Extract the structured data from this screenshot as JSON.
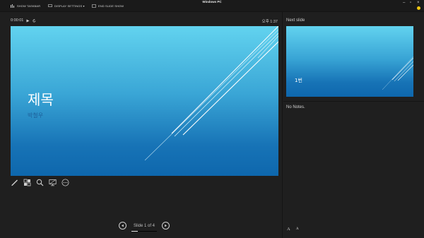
{
  "app": {
    "title": "Windows PC"
  },
  "toolbar": {
    "show_taskbar": "SHOW TASKBAR",
    "display_settings": "DISPLAY SETTINGS ▾",
    "end_slide_show": "END SLIDE SHOW"
  },
  "presenter": {
    "timer": "0:00:01",
    "clock": "오후 1:37"
  },
  "current_slide": {
    "title": "제목",
    "subtitle": "박철우"
  },
  "next_slide": {
    "label": "Next slide",
    "text": "1번"
  },
  "notes": {
    "text": "No Notes."
  },
  "navigation": {
    "counter": "Slide 1 of 4",
    "progress": 0.25
  },
  "font_controls": {
    "increase": "A",
    "decrease": "A"
  },
  "icons": [
    "pen-icon",
    "slides-grid-icon",
    "zoom-icon",
    "screen-icon",
    "more-icon",
    "play-icon",
    "reset-icon",
    "prev-icon",
    "next-icon"
  ]
}
